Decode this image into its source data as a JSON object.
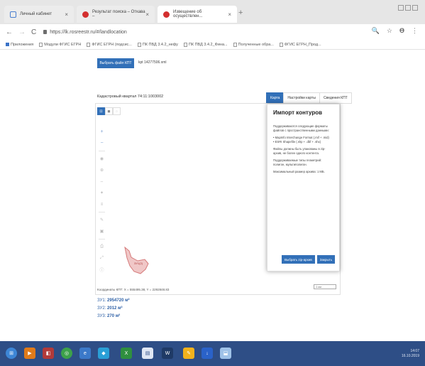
{
  "browser": {
    "tabs": [
      {
        "label": "Личный кабинет",
        "favicon_color": "#4a7fd0"
      },
      {
        "label": "Результат поиска – Откава – ",
        "favicon_color": "#d32f2f"
      },
      {
        "label": "Извещение об осуществлен...",
        "favicon_color": "#d32f2f"
      }
    ],
    "new_tab": "+",
    "url": "https://lk.rosreestr.ru/#/landlocation",
    "back": "←",
    "forward": "→",
    "reload": "C",
    "search_icon": "🔍",
    "star_icon": "☆",
    "menu_icon": "⋮"
  },
  "bookmarks": [
    "Приложения",
    "Модули ФГИС ЕГРН",
    "ФГИС ЕГРН (подсис...",
    "ПК ПВД 3.4.2_нефу",
    "ПК ПВД 3.4.2_Фина...",
    "Полученные обра...",
    "ФГИС ЕГРН_Прод..."
  ],
  "page": {
    "select_file_button": "Выбрать файл КПТ",
    "file_name": "kpt 14277506.xml",
    "panel_title": "Кадастровый квартал 74:11:1003002",
    "panel_tabs": [
      "Карта",
      "Настройки карты",
      "Сведения КПТ"
    ],
    "active_panel_tab": 0,
    "coords_text": "Координаты КПТ: X = 555495.38, Y = 2292848.83",
    "scale_text": "1 км",
    "contour_label": "ЗУ1(2)"
  },
  "popup": {
    "title": "Импорт контуров",
    "intro": "Поддерживаются следующие форматы файлов с пространственными данными:",
    "formats": [
      "MapInfo Interchange Format (.mif + .mid)",
      "ESRI Shapefile (.shp + .dbf + .shx)"
    ],
    "note1": "Файлы должны быть упакованы в zip-архив, не более одного контента.",
    "note2": "Поддерживаемые типы геометрий: полигон, мультиполигон.",
    "note3": "Максимальный размер архива: 1 МБ.",
    "buttons": [
      "Выбрать zip-архив",
      "Закрыть"
    ]
  },
  "areas": [
    {
      "label": "ЗУ1:",
      "value": "2954720 м²"
    },
    {
      "label": "ЗУ2:",
      "value": "2012 м²"
    },
    {
      "label": "ЗУ3:",
      "value": "270 м²"
    }
  ],
  "taskbar": {
    "icons": [
      "start",
      "media-player",
      "notes",
      "chrome",
      "ie",
      "maps",
      "excel",
      "files",
      "word",
      "paint",
      "firefox",
      "download",
      "app"
    ],
    "time": "14:07",
    "date": "16.10.2019"
  }
}
